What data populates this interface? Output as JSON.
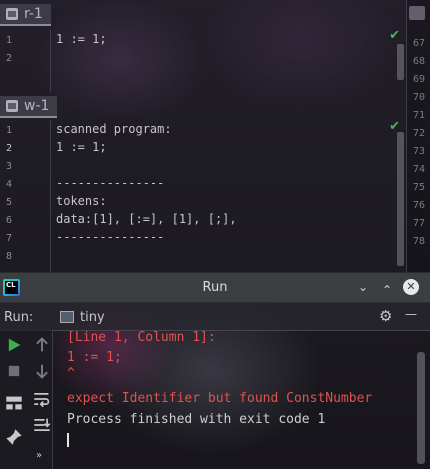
{
  "editor_top": {
    "tab_label": "r-1",
    "line_numbers": [
      "1",
      "2"
    ],
    "lines": [
      "1 := 1;",
      ""
    ]
  },
  "editor_bottom": {
    "tab_label": "w-1",
    "line_numbers": [
      "1",
      "2",
      "3",
      "4",
      "5",
      "6",
      "7",
      "8"
    ],
    "lines": [
      "scanned program:",
      "1 := 1;",
      "",
      "---------------",
      "tokens:",
      "data:[1], [:=], [1], [;],",
      "---------------",
      ""
    ]
  },
  "right_editor": {
    "line_numbers": [
      "67",
      "68",
      "69",
      "70",
      "71",
      "72",
      "73",
      "74",
      "75",
      "76",
      "77",
      "78"
    ]
  },
  "run_panel": {
    "title": "Run",
    "run_label": "Run:",
    "config_name": "tiny",
    "output": [
      {
        "text": "[Line 1, Column 1]:",
        "kind": "error"
      },
      {
        "text": "1 := 1;",
        "kind": "error"
      },
      {
        "text": "^",
        "kind": "error"
      },
      {
        "text": "expect Identifier but found ConstNumber",
        "kind": "error"
      },
      {
        "text": "Process finished with exit code 1",
        "kind": "normal"
      }
    ]
  },
  "colors": {
    "error_text": "#e0524e",
    "ok_check": "#4fb35a",
    "run_green": "#3fae4a"
  },
  "icons": {
    "chevron_down": "⌄",
    "chevron_up": "⌃",
    "close": "✕",
    "gear": "⚙",
    "minimize": "—"
  }
}
